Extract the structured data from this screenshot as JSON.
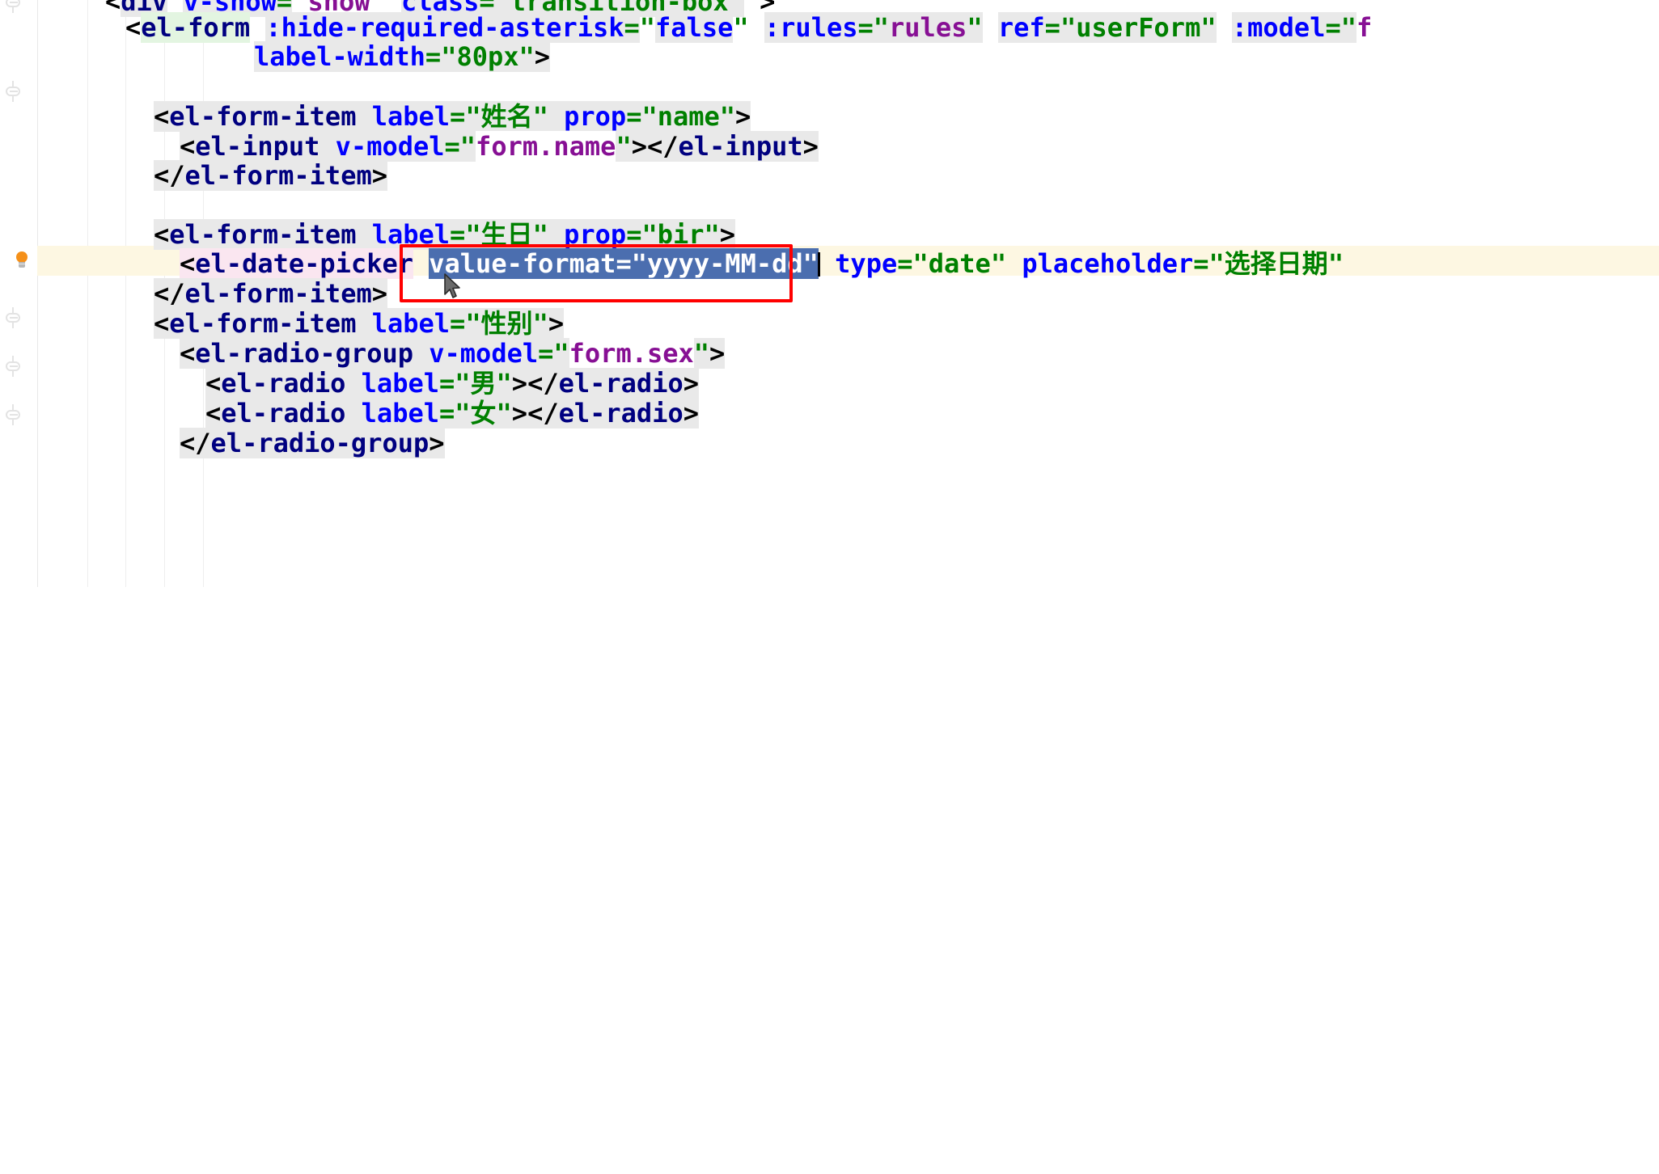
{
  "app": {
    "kind": "code-editor",
    "language": "vue-html-template",
    "theme": "light"
  },
  "colors": {
    "tag": "#000080",
    "attribute": "#0000ff",
    "string": "#008000",
    "value_expression": "#871094",
    "selection_background": "#4b6eaf",
    "selection_text": "#ffffff",
    "caret_line_background": "#fdf7e2",
    "occurrence_background": "#e9e9e9",
    "annotation_box": "#ff0000",
    "bulb": "#f59019"
  },
  "gutter": {
    "intention_bulb_icon": "lightbulb-icon",
    "fold_markers": [
      "fold-marker",
      "fold-marker",
      "fold-marker",
      "fold-marker",
      "fold-marker"
    ]
  },
  "annotation": {
    "red_box_label": "value-format=\"yyyy-MM-dd\"",
    "selected_text": "value-format=\"yyyy-MM-dd\"",
    "cursor_icon": "mouse-pointer-icon"
  },
  "code": {
    "lines": [
      {
        "id": "line-div",
        "indent": 0,
        "text": "<div v-show=\"show\" class=\"transition-box\">",
        "clipped_top": true,
        "tokens": [
          {
            "t": "<",
            "c": "punct"
          },
          {
            "t": "div",
            "c": "tag",
            "hl": "occ"
          },
          {
            "t": " ",
            "c": "plain"
          },
          {
            "t": "v-show",
            "c": "attr"
          },
          {
            "t": "=",
            "c": "eq"
          },
          {
            "t": "\"",
            "c": "str"
          },
          {
            "t": "show",
            "c": "val",
            "hl": "occw"
          },
          {
            "t": "\"",
            "c": "str"
          },
          {
            "t": " ",
            "c": "plain"
          },
          {
            "t": "class",
            "c": "attr"
          },
          {
            "t": "=",
            "c": "eq"
          },
          {
            "t": "\"",
            "c": "str"
          },
          {
            "t": "transition-box",
            "c": "str"
          },
          {
            "t": "\"",
            "c": "str"
          },
          {
            "t": ">",
            "c": "punct"
          }
        ]
      },
      {
        "id": "line-el-form-open",
        "text": "<el-form :hide-required-asterisk=\"false\" :rules=\"rules\" ref=\"userForm\" :model=\"f"
      },
      {
        "id": "line-label-width",
        "text": "label-width=\"80px\">"
      },
      {
        "id": "line-form-item-name",
        "text": "<el-form-item label=\"姓名\" prop=\"name\">"
      },
      {
        "id": "line-el-input",
        "text": "<el-input v-model=\"form.name\"></el-input>"
      },
      {
        "id": "line-form-item-name-close",
        "text": "</el-form-item>"
      },
      {
        "id": "line-form-item-bir",
        "text": "<el-form-item label=\"生日\" prop=\"bir\">"
      },
      {
        "id": "line-date-picker",
        "text": "<el-date-picker value-format=\"yyyy-MM-dd\" type=\"date\" placeholder=\"选择日期\"",
        "caret_line": true,
        "has_selection": true
      },
      {
        "id": "line-form-item-bir-close",
        "text": "</el-form-item>"
      },
      {
        "id": "line-form-item-sex",
        "text": "<el-form-item label=\"性别\">"
      },
      {
        "id": "line-radio-group",
        "text": "<el-radio-group v-model=\"form.sex\">"
      },
      {
        "id": "line-radio-male",
        "text": "<el-radio label=\"男\"></el-radio>"
      },
      {
        "id": "line-radio-female",
        "text": "<el-radio label=\"女\"></el-radio>"
      },
      {
        "id": "line-radio-group-close",
        "text": "</el-radio-group>",
        "clipped_bottom": true
      }
    ],
    "strings": {
      "label_name": "姓名",
      "prop_name": "name",
      "label_bir": "生日",
      "prop_bir": "bir",
      "label_sex": "性别",
      "label_male": "男",
      "label_female": "女",
      "placeholder_date": "选择日期",
      "value_format": "yyyy-MM-dd",
      "picker_type": "date",
      "label_width": "80px",
      "hide_required_asterisk": "false",
      "rules": "rules",
      "ref": "userForm",
      "class_transition_box": "transition-box",
      "model_form_name": "form.name",
      "model_form_sex": "form.sex",
      "v_show": "show"
    }
  }
}
